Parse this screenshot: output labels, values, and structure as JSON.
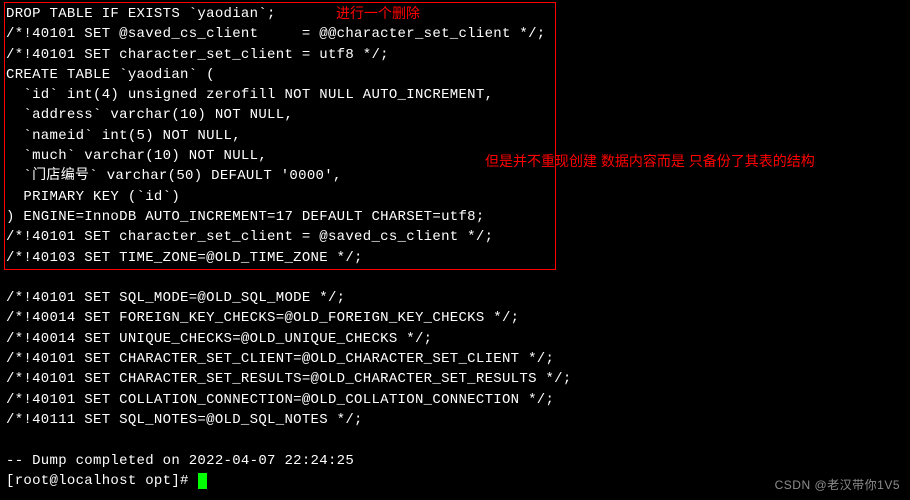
{
  "terminal": {
    "lines": [
      "DROP TABLE IF EXISTS `yaodian`;",
      "/*!40101 SET @saved_cs_client     = @@character_set_client */;",
      "/*!40101 SET character_set_client = utf8 */;",
      "CREATE TABLE `yaodian` (",
      "  `id` int(4) unsigned zerofill NOT NULL AUTO_INCREMENT,",
      "  `address` varchar(10) NOT NULL,",
      "  `nameid` int(5) NOT NULL,",
      "  `much` varchar(10) NOT NULL,",
      "  `门店编号` varchar(50) DEFAULT '0000',",
      "  PRIMARY KEY (`id`)",
      ") ENGINE=InnoDB AUTO_INCREMENT=17 DEFAULT CHARSET=utf8;",
      "/*!40101 SET character_set_client = @saved_cs_client */;",
      "/*!40103 SET TIME_ZONE=@OLD_TIME_ZONE */;",
      "",
      "/*!40101 SET SQL_MODE=@OLD_SQL_MODE */;",
      "/*!40014 SET FOREIGN_KEY_CHECKS=@OLD_FOREIGN_KEY_CHECKS */;",
      "/*!40014 SET UNIQUE_CHECKS=@OLD_UNIQUE_CHECKS */;",
      "/*!40101 SET CHARACTER_SET_CLIENT=@OLD_CHARACTER_SET_CLIENT */;",
      "/*!40101 SET CHARACTER_SET_RESULTS=@OLD_CHARACTER_SET_RESULTS */;",
      "/*!40101 SET COLLATION_CONNECTION=@OLD_COLLATION_CONNECTION */;",
      "/*!40111 SET SQL_NOTES=@OLD_SQL_NOTES */;",
      "",
      "-- Dump completed on 2022-04-07 22:24:25"
    ],
    "prompt": "[root@localhost opt]# "
  },
  "annotations": {
    "top": "进行一个删除",
    "right": "但是并不重现创建 数据内容而是 只备份了其表的结构"
  },
  "watermark": "CSDN @老汉带你1V5"
}
